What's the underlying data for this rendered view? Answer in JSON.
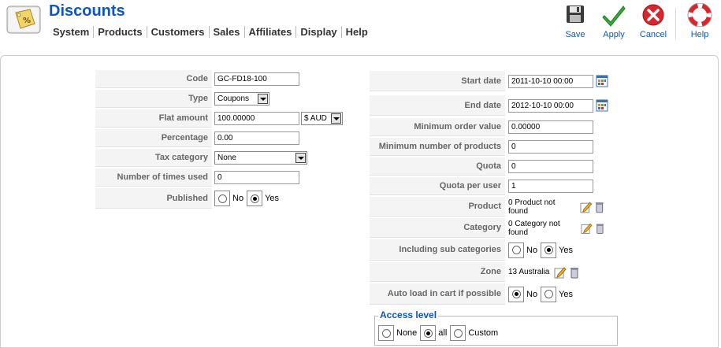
{
  "header": {
    "title": "Discounts",
    "menu": [
      "System",
      "Products",
      "Customers",
      "Sales",
      "Affiliates",
      "Display",
      "Help"
    ]
  },
  "toolbar": {
    "save": "Save",
    "apply": "Apply",
    "cancel": "Cancel",
    "help": "Help"
  },
  "left": {
    "code": {
      "label": "Code",
      "value": "GC-FD18-100"
    },
    "type": {
      "label": "Type",
      "value": "Coupons"
    },
    "flat_amount": {
      "label": "Flat amount",
      "value": "100.00000",
      "currency": "$ AUD"
    },
    "percentage": {
      "label": "Percentage",
      "value": "0.00"
    },
    "tax_category": {
      "label": "Tax category",
      "value": "None"
    },
    "times_used": {
      "label": "Number of times used",
      "value": "0"
    },
    "published": {
      "label": "Published",
      "no": "No",
      "yes": "Yes",
      "selected": "Yes"
    }
  },
  "right": {
    "start_date": {
      "label": "Start date",
      "value": "2011-10-10 00:00"
    },
    "end_date": {
      "label": "End date",
      "value": "2012-10-10 00:00"
    },
    "min_order": {
      "label": "Minimum order value",
      "value": "0.00000"
    },
    "min_products": {
      "label": "Minimum number of products",
      "value": "0"
    },
    "quota": {
      "label": "Quota",
      "value": "0"
    },
    "quota_per_user": {
      "label": "Quota per user",
      "value": "1"
    },
    "product": {
      "label": "Product",
      "value": "0 Product not found"
    },
    "category": {
      "label": "Category",
      "value": "0 Category not found"
    },
    "sub_categories": {
      "label": "Including sub categories",
      "no": "No",
      "yes": "Yes",
      "selected": "Yes"
    },
    "zone": {
      "label": "Zone",
      "value": "13 Australia"
    },
    "auto_load": {
      "label": "Auto load in cart if possible",
      "no": "No",
      "yes": "Yes",
      "selected": "No"
    }
  },
  "access": {
    "legend": "Access level",
    "none": "None",
    "all": "all",
    "custom": "Custom",
    "selected": "all"
  },
  "colors": {
    "title": "#0b55c4",
    "label_bg": "#f4f4f4"
  }
}
